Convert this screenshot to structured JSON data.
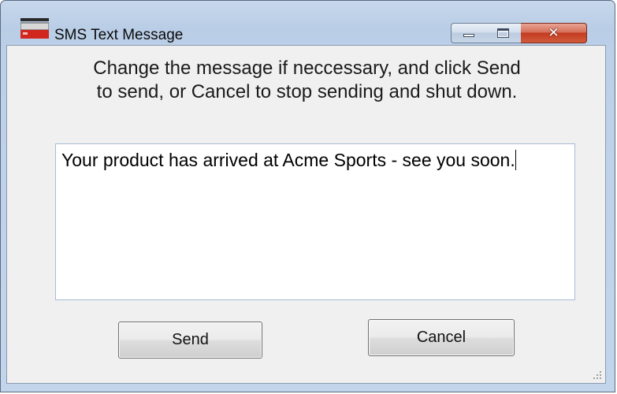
{
  "window": {
    "title": "SMS Text Message",
    "icon": "sms-app-icon",
    "controls": {
      "minimize_icon": "minimize-icon",
      "maximize_icon": "maximize-icon",
      "close_icon": "close-icon",
      "close_glyph": "✕"
    }
  },
  "dialog": {
    "instruction_line1": "Change the message if neccessary, and click Send",
    "instruction_line2": "to send, or Cancel to stop sending and shut down.",
    "message_text": "Your product has arrived at Acme Sports - see you soon.",
    "send_label": "Send",
    "cancel_label": "Cancel"
  },
  "colors": {
    "close_button": "#c43b20",
    "frame": "#b9cde6",
    "client_background": "#f0f0f0"
  }
}
